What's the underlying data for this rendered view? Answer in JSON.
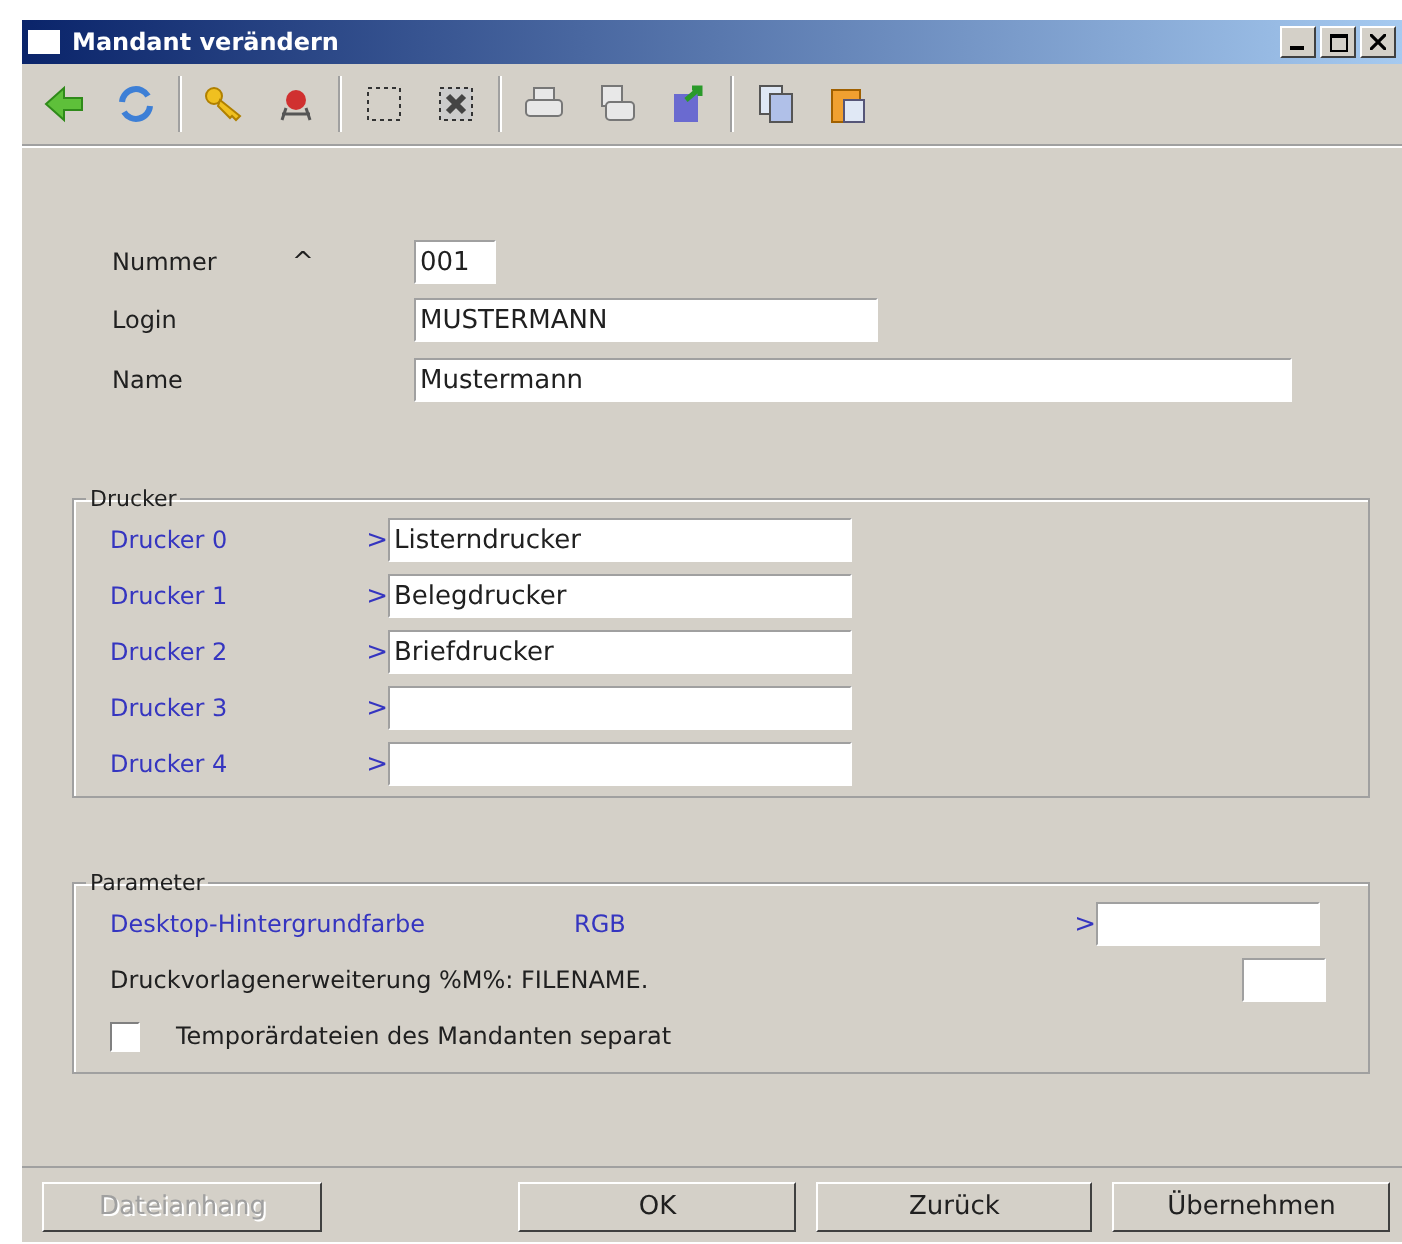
{
  "window": {
    "title": "Mandant verändern"
  },
  "fields": [
    {
      "label": "Nummer",
      "marker": "^",
      "value": "001"
    },
    {
      "label": "Login",
      "value": "MUSTERMANN"
    },
    {
      "label": "Name",
      "value": "Mustermann"
    }
  ],
  "drucker": {
    "title": "Drucker",
    "rows": [
      {
        "label": "Drucker 0",
        "arrow": ">",
        "value": "Listerndrucker"
      },
      {
        "label": "Drucker 1",
        "arrow": ">",
        "value": "Belegdrucker"
      },
      {
        "label": "Drucker 2",
        "arrow": ">",
        "value": "Briefdrucker"
      },
      {
        "label": "Drucker 3",
        "arrow": ">"
      },
      {
        "label": "Drucker 4",
        "arrow": ">"
      }
    ]
  },
  "parameter": {
    "title": "Parameter",
    "color_row": {
      "label": "Desktop-Hintergrundfarbe",
      "unit": "RGB",
      "arrow": ">"
    },
    "extension_row": {
      "label": "Druckvorlagenerweiterung %M%: FILENAME."
    },
    "checkbox": {
      "label": "Temporärdateien des Mandanten separat",
      "checked": false
    }
  },
  "buttons": [
    {
      "label": "Dateianhang",
      "disabled": true
    },
    {
      "label": "OK",
      "disabled": false
    },
    {
      "label": "Zurück",
      "disabled": false
    },
    {
      "label": "Übernehmen",
      "disabled": false
    }
  ]
}
